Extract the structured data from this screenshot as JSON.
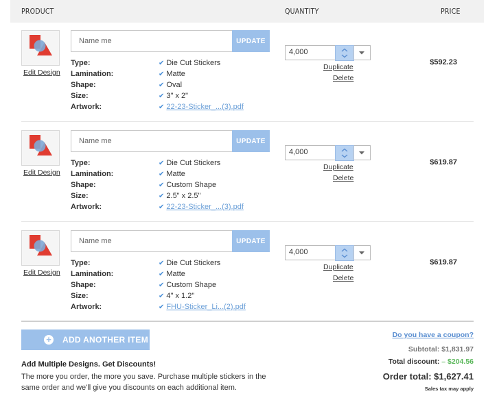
{
  "header": {
    "product": "PRODUCT",
    "quantity": "QUANTITY",
    "price": "PRICE"
  },
  "labels": {
    "edit_design": "Edit Design",
    "name_placeholder": "Name me",
    "update": "UPDATE",
    "duplicate": "Duplicate",
    "delete": "Delete",
    "type": "Type:",
    "lamination": "Lamination:",
    "shape": "Shape:",
    "size": "Size:",
    "artwork": "Artwork:"
  },
  "items": [
    {
      "type": "Die Cut Stickers",
      "lamination": "Matte",
      "shape": "Oval",
      "size": "3\" x 2\"",
      "artwork": "22-23-Sticker_...(3).pdf",
      "quantity": "4,000",
      "price": "$592.23"
    },
    {
      "type": "Die Cut Stickers",
      "lamination": "Matte",
      "shape": "Custom Shape",
      "size": "2.5\" x 2.5\"",
      "artwork": "22-23-Sticker_...(3).pdf",
      "quantity": "4,000",
      "price": "$619.87"
    },
    {
      "type": "Die Cut Stickers",
      "lamination": "Matte",
      "shape": "Custom Shape",
      "size": "4\" x 1.2\"",
      "artwork": "FHU-Sticker_Li...(2).pdf",
      "quantity": "4,000",
      "price": "$619.87"
    }
  ],
  "add_item": "ADD ANOTHER ITEM",
  "promo": {
    "title": "Add Multiple Designs. Get Discounts!",
    "text": "The more you order, the more you save. Purchase multiple stickers in the same order and we'll give you discounts on each additional item."
  },
  "summary": {
    "coupon": "Do you have a coupon?",
    "subtotal_label": "Subtotal:",
    "subtotal": "$1,831.97",
    "discount_label": "Total discount:",
    "discount": "– $204.56",
    "total_label": "Order total:",
    "total": "$1,627.41",
    "tax_note": "Sales tax may apply"
  },
  "colors": {
    "accent": "#9cc0ea",
    "link": "#5b8fd1",
    "discount": "#5cb85c",
    "check": "#4a90d9"
  }
}
